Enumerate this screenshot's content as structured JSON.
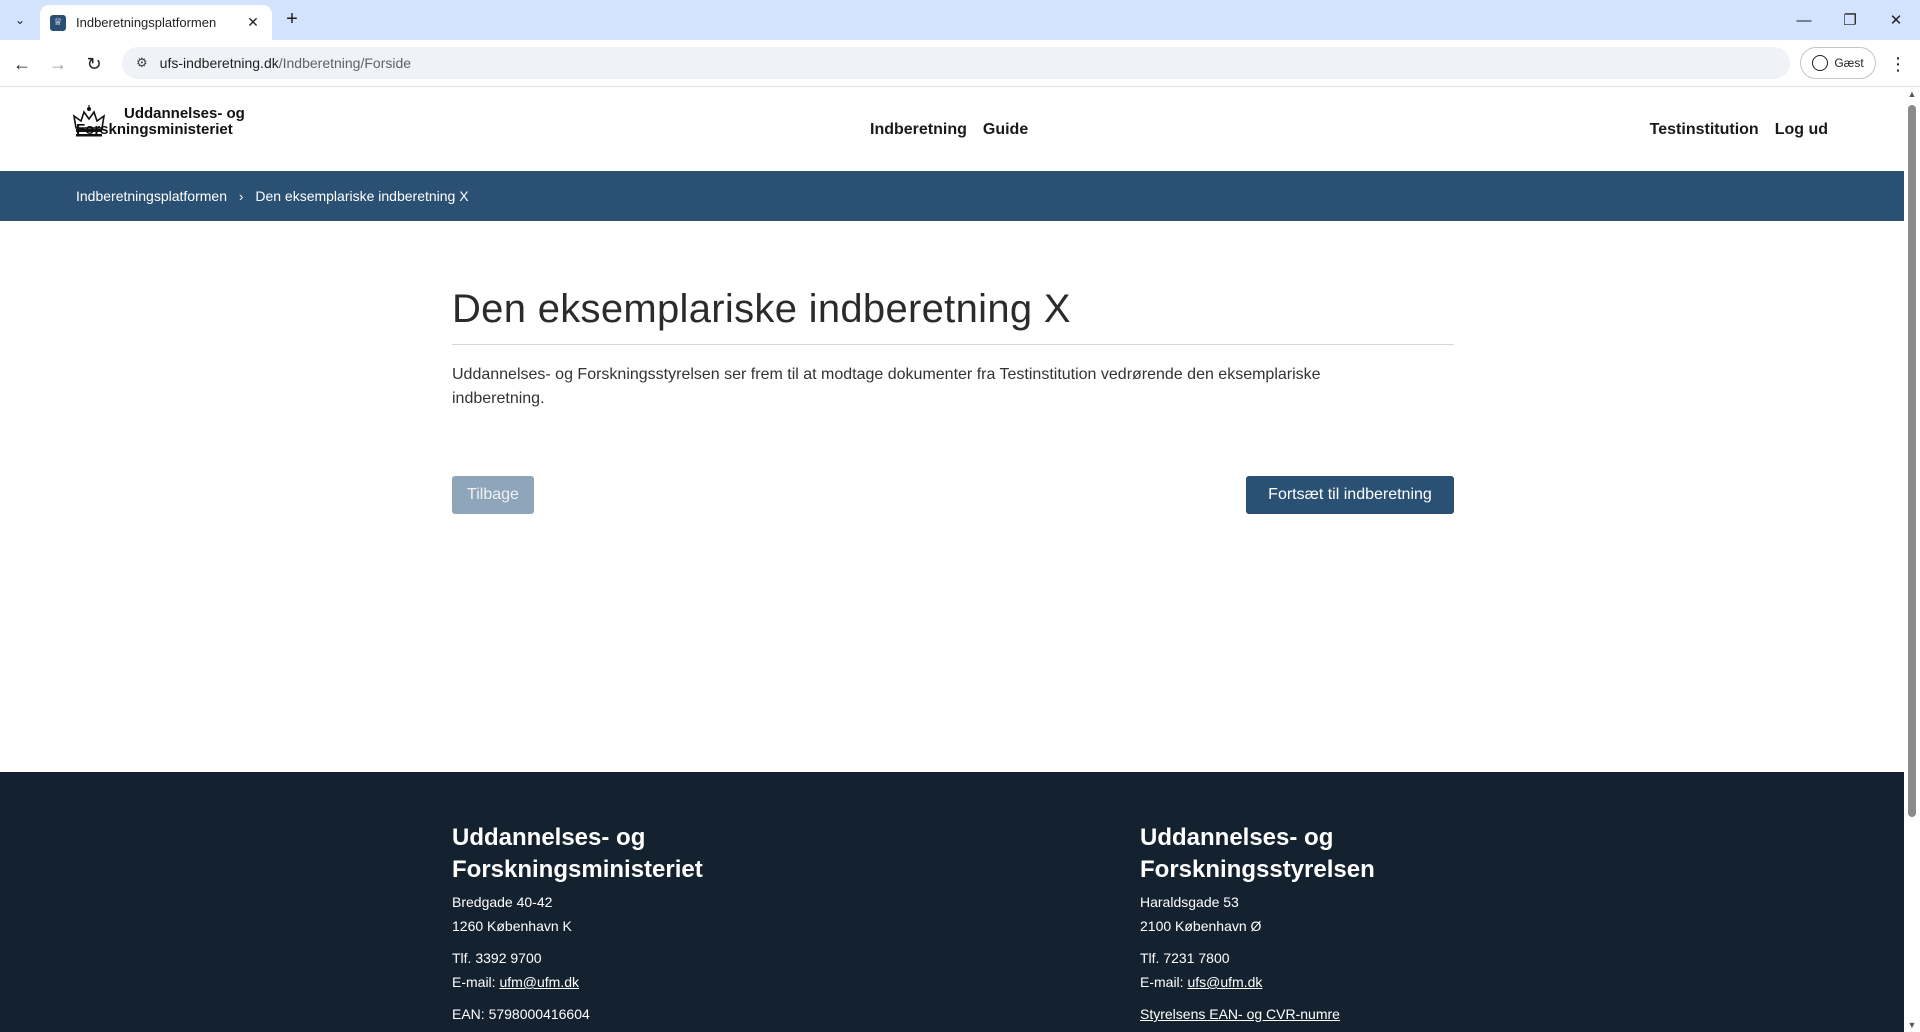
{
  "browser": {
    "tab_title": "Indberetningsplatformen",
    "url_host": "ufs-indberetning.dk",
    "url_path": "/Indberetning/Forside",
    "profile_label": "Gæst"
  },
  "header": {
    "logo_line1": "Uddannelses- og",
    "logo_line2": "Forskningsministeriet",
    "nav": [
      "Indberetning",
      "Guide"
    ],
    "user_nav": [
      "Testinstitution",
      "Log ud"
    ]
  },
  "breadcrumb": [
    "Indberetningsplatformen",
    "Den eksemplariske indberetning X"
  ],
  "main": {
    "title": "Den eksemplariske indberetning X",
    "intro": "Uddannelses- og Forskningsstyrelsen ser frem til at modtage dokumenter fra Testinstitution vedrørende den eksemplariske indberetning.",
    "back_label": "Tilbage",
    "continue_label": "Fortsæt til indberetning"
  },
  "footer": {
    "ministry": {
      "name_line1": "Uddannelses- og",
      "name_line2": "Forskningsministeriet",
      "street": "Bredgade 40-42",
      "city": "1260 København K",
      "phone": "Tlf. 3392 9700",
      "email_label": "E-mail: ",
      "email": "ufm@ufm.dk",
      "ean": "EAN: 5798000416604"
    },
    "agency": {
      "name_line1": "Uddannelses- og",
      "name_line2": "Forskningsstyrelsen",
      "street": "Haraldsgade 53",
      "city": "2100 København Ø",
      "phone": "Tlf. 7231 7800",
      "email_label": "E-mail: ",
      "email": "ufs@ufm.dk",
      "ean_link": "Styrelsens EAN- og CVR-numre"
    }
  },
  "colors": {
    "brand_blue": "#2a5073",
    "footer_bg": "#142230",
    "back_button": "#8fa5b9"
  }
}
